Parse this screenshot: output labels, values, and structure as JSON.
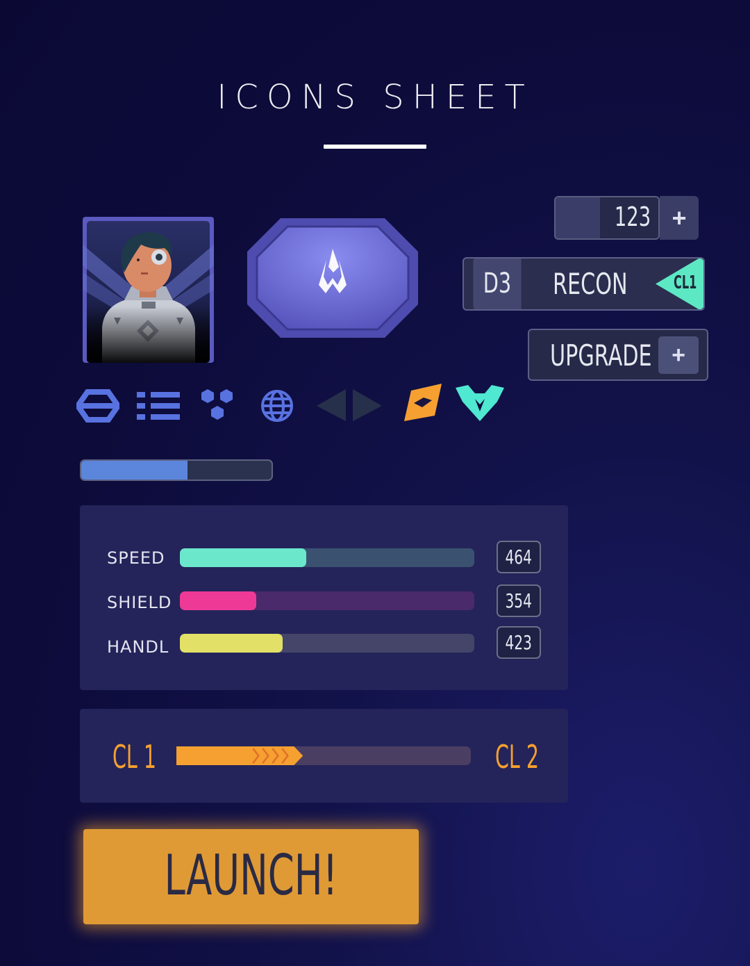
{
  "title": "ICONS SHEET",
  "counter": {
    "value": "123",
    "plus_label": "+"
  },
  "ship_card": {
    "level": "D3",
    "name": "RECON",
    "class_tag": "CL1"
  },
  "upgrade_button": {
    "label": "UPGRADE",
    "plus_label": "+"
  },
  "icon_row": [
    "hexagon-ring-icon",
    "list-icon",
    "hex-cluster-icon",
    "globe-icon",
    "arrow-left-icon",
    "arrow-right-icon",
    "orange-diamond-icon",
    "teal-ship-emblem-icon"
  ],
  "progress_bar": {
    "fill_fraction": 0.56,
    "color": "#5b86dc"
  },
  "stats": [
    {
      "label": "SPEED",
      "value": "464",
      "fill_fraction": 0.43,
      "fill_color": "#6be8cc",
      "track_color": "#3a5270"
    },
    {
      "label": "SHIELD",
      "value": "354",
      "fill_fraction": 0.26,
      "fill_color": "#ee3a96",
      "track_color": "#4a2a6a"
    },
    {
      "label": "HANDL",
      "value": "423",
      "fill_fraction": 0.35,
      "fill_color": "#e2e066",
      "track_color": "#45456a"
    }
  ],
  "class_progress": {
    "from_label": "CL 1",
    "to_label": "CL 2",
    "fill_fraction": 0.43,
    "color": "#f5a030"
  },
  "launch_button": {
    "label": "LAUNCH!"
  },
  "colors": {
    "background": "#0d0b3a",
    "accent_orange": "#e09a35",
    "accent_teal": "#4fe8d0",
    "panel": "#24245a"
  }
}
